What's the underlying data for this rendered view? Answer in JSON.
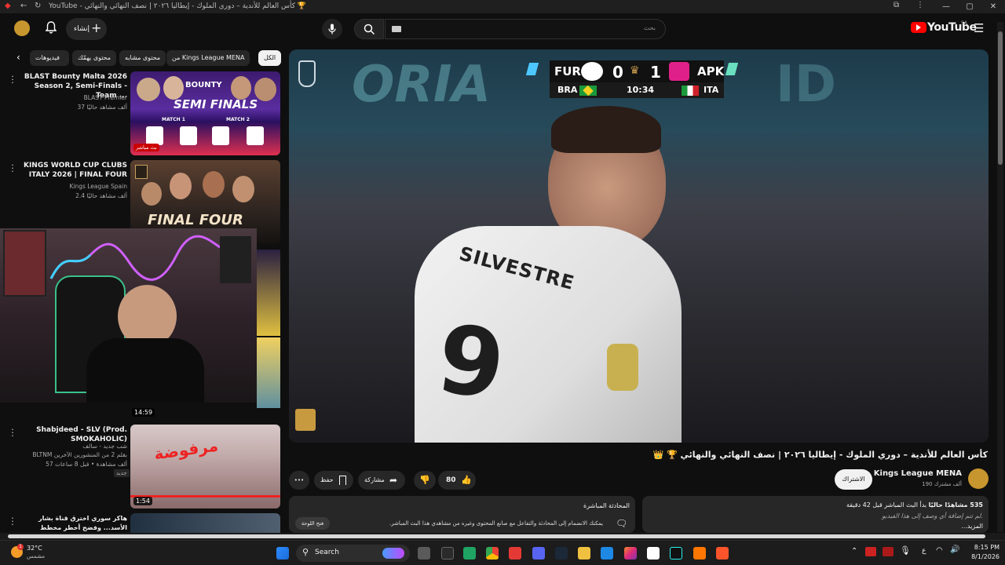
{
  "browser": {
    "tab_title": "YouTube - كأس العالم للأندية – دوري الملوك - إيطاليا ٢٠٢٦ | نصف النهائي والنهائي 🏆",
    "window_buttons": [
      "—",
      "▢",
      "✕"
    ]
  },
  "header": {
    "create_label": "إنشاء",
    "search_placeholder": "بحث",
    "logo_text": "YouTube",
    "logo_region": "SA"
  },
  "chips": [
    {
      "label": "الكل",
      "selected": true
    },
    {
      "label": "من Kings League MENA",
      "selected": false
    },
    {
      "label": "محتوى مشابه",
      "selected": false
    },
    {
      "label": "محتوى يهمّك",
      "selected": false
    },
    {
      "label": "فيديوهات",
      "selected": false
    }
  ],
  "sidebar": {
    "items": [
      {
        "title": "BLAST Bounty Malta 2026 Season 2, Semi-Finals - Team ...",
        "channel": "BLAST Premier",
        "meta": "37 ألف مشاهد حاليًا",
        "badge": "بث مباشر"
      },
      {
        "title": "KINGS WORLD CUP CLUBS ITALY 2026 | FINAL FOUR",
        "channel": "Kings League Spain",
        "meta": "2.4 ألف مشاهد حاليًا",
        "badge": ""
      },
      {
        "title": "Shabjdeed - SLV (Prod. SMOKAHOLIC)",
        "channel": "BLTNM",
        "meta": "57 ألف مشاهدة • قبل 8 ساعات",
        "extra": "شب جديد - سالف",
        "extra2": "بقلم 2 من المنشورين الآخرين",
        "badge": "جديد",
        "duration": "1:54"
      },
      {
        "title": "هاكر سوري اخترق قناة بشار الأسد... وفضح أخطر مخطط للموساد!",
        "channel": "",
        "meta": "",
        "badge": ""
      }
    ],
    "webcam_duration": "14:59",
    "blast_thumb": {
      "text1": "BOUNTY",
      "text2": "SEMI FINALS",
      "match1": "MATCH 1",
      "match2": "MATCH 2"
    },
    "kings_thumb": {
      "text": "FINAL FOUR"
    }
  },
  "player": {
    "scoreboard": {
      "team1": "FUR",
      "team2": "APK",
      "score1": "0",
      "score2": "1",
      "country1": "BRA",
      "country2": "ITA",
      "clock": "10:34"
    },
    "shirt_name": "SILVESTRE",
    "shirt_number": "9"
  },
  "video": {
    "title": "كأس العالم للأندية – دوري الملوك - إيطاليا ٢٠٢٦ | نصف النهائي والنهائي 🏆 👑",
    "channel": "Kings League MENA",
    "subscribers": "190 ألف مشترك",
    "subscribe_label": "الاشتراك",
    "likes": "80",
    "share_label": "مشاركة",
    "save_label": "حفظ",
    "more_label": "•••"
  },
  "description": {
    "viewers": "535 مشاهدًا حاليًا",
    "started": "بدأ البث المباشر قبل 42 دقيقة",
    "empty": "لم تتم إضافة أي وصف إلى هذا الفيديو.",
    "more": "...المزيد"
  },
  "chat": {
    "title": "المحادثة المباشرة",
    "body": "يمكنك الانضمام إلى المحادثة والتفاعل مع صانع المحتوى وغيره من مشاهدي هذا البث المباشر.",
    "open_label": "فتح اللوحة"
  },
  "taskbar": {
    "weather_temp": "32°C",
    "weather_desc": "مشمس",
    "search_label": "Search",
    "time": "8:15 PM",
    "date": "8/1/2026",
    "lang": "ع",
    "badge_count": "1"
  },
  "colors": {
    "accent_red": "#ff0000",
    "bg": "#0f0f0f"
  }
}
